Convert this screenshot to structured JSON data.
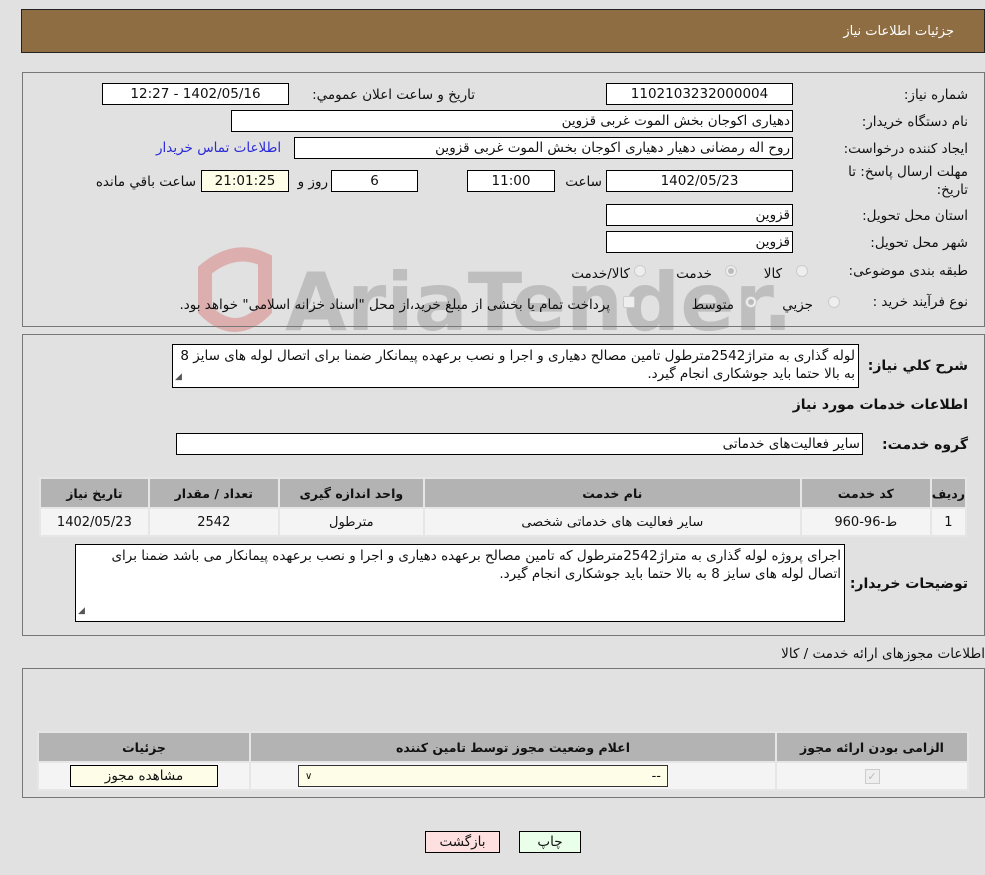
{
  "header": {
    "title": "جزئیات اطلاعات نیاز"
  },
  "form": {
    "need_number": {
      "label": "شماره نیاز:",
      "value": "1102103232000004"
    },
    "announce_datetime": {
      "label": "تاریخ و ساعت اعلان عمومي:",
      "value": "1402/05/16 - 12:27"
    },
    "buyer_org": {
      "label": "نام دستگاه خریدار:",
      "value": "دهیاری اکوجان بخش الموت غربی قزوین"
    },
    "requester": {
      "label": "ایجاد کننده درخواست:",
      "value": "روح اله رمضانی دهیار دهیاری اکوجان بخش الموت غربی قزوین"
    },
    "contact_link": "اطلاعات تماس خریدار",
    "deadline": {
      "label_line1": "مهلت ارسال پاسخ: تا",
      "label_line2": "تاریخ:",
      "date": "1402/05/23",
      "time_label": "ساعت",
      "time": "11:00",
      "days": "6",
      "days_label": "روز و",
      "remaining": "21:01:25",
      "remaining_label": "ساعت باقي مانده"
    },
    "province": {
      "label": "استان محل تحویل:",
      "value": "قزوین"
    },
    "city": {
      "label": "شهر محل تحویل:",
      "value": "قزوین"
    },
    "category": {
      "label": "طبقه بندی موضوعی:",
      "options": [
        "کالا",
        "خدمت",
        "کالا/خدمت"
      ],
      "selected": "خدمت"
    },
    "purchase_type": {
      "label": "نوع فرآیند خرید :",
      "options": [
        "جزيي",
        "متوسط"
      ],
      "selected": "متوسط",
      "treasury_note": "پرداخت تمام یا بخشی از مبلغ خرید،از محل \"اسناد خزانه اسلامی\" خواهد بود."
    }
  },
  "description": {
    "label": "شرح کلي نیاز:",
    "value": "لوله گذاری به متراژ2542مترطول تامین مصالح دهیاری و اجرا و نصب برعهده پیمانکار ضمنا برای اتصال لوله های سایز 8 به بالا حتما باید جوشکاری انجام گیرد."
  },
  "services": {
    "section_title": "اطلاعات خدمات مورد نیاز",
    "group_label": "گروه خدمت:",
    "group_value": "سایر فعالیت‌های خدماتی",
    "columns": [
      "ردیف",
      "کد خدمت",
      "نام خدمت",
      "واحد اندازه گیری",
      "تعداد / مقدار",
      "تاریخ نیاز"
    ],
    "rows": [
      [
        "1",
        "ط-96-960",
        "سایر فعالیت های خدماتی شخصی",
        "مترطول",
        "2542",
        "1402/05/23"
      ]
    ]
  },
  "buyer_notes": {
    "label": "توضیحات خریدار:",
    "value": "اجرای پروژه لوله گذاری به متراژ2542مترطول که تامین مصالح برعهده دهیاری و اجرا و نصب برعهده پیمانکار می باشد ضمنا برای اتصال لوله های سایز 8 به بالا حتما باید جوشکاری انجام گیرد."
  },
  "permits": {
    "section_title": "اطلاعات مجوزهای ارائه خدمت / کالا",
    "columns": [
      "الزامی بودن ارائه مجوز",
      "اعلام وضعیت مجوز توسط تامین کننده",
      "جزئیات"
    ],
    "row": {
      "required_checked": true,
      "status_select": "--",
      "details_button": "مشاهده مجوز"
    }
  },
  "buttons": {
    "back": "بازگشت",
    "print": "چاپ"
  },
  "watermark": "AriaTender.neT",
  "colors": {
    "header_bg": "#8f6d43",
    "link": "#2b2bd8",
    "back_btn": "#ffe0e0",
    "print_btn": "#eaffea"
  }
}
